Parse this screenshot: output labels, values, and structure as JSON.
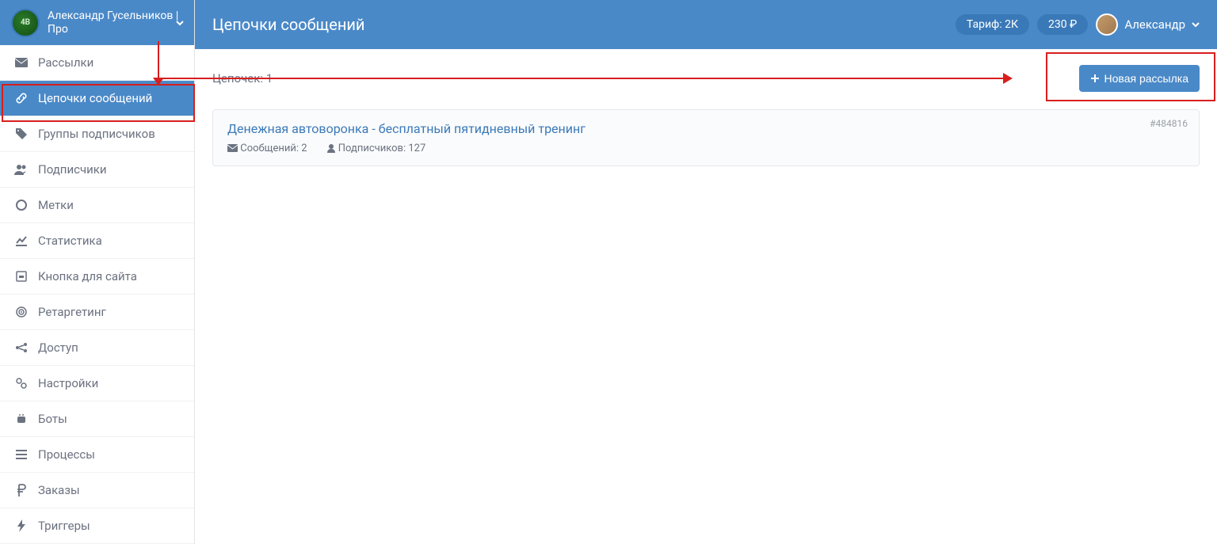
{
  "sidebar": {
    "profile": {
      "name": "Александр Гусельников | Про",
      "avatar_text": "4B"
    },
    "items": [
      {
        "label": "Рассылки",
        "icon": "envelope"
      },
      {
        "label": "Цепочки сообщений",
        "icon": "chain",
        "active": true
      },
      {
        "label": "Группы подписчиков",
        "icon": "tags"
      },
      {
        "label": "Подписчики",
        "icon": "users"
      },
      {
        "label": "Метки",
        "icon": "circle"
      },
      {
        "label": "Статистика",
        "icon": "chart"
      },
      {
        "label": "Кнопка для сайта",
        "icon": "widget"
      },
      {
        "label": "Ретаргетинг",
        "icon": "target"
      },
      {
        "label": "Доступ",
        "icon": "share"
      },
      {
        "label": "Настройки",
        "icon": "cogs"
      },
      {
        "label": "Боты",
        "icon": "android"
      },
      {
        "label": "Процессы",
        "icon": "tasks"
      },
      {
        "label": "Заказы",
        "icon": "ruble"
      },
      {
        "label": "Триггеры",
        "icon": "bolt"
      }
    ]
  },
  "header": {
    "title": "Цепочки сообщений",
    "tariff": "Тариф: 2К",
    "balance": "230 ₽",
    "user_name": "Александр"
  },
  "content": {
    "count_text": "Цепочек: 1",
    "new_button": "Новая рассылка",
    "cards": [
      {
        "title": "Денежная автоворонка - бесплатный пятидневный тренинг",
        "messages": "Сообщений: 2",
        "subscribers": "Подписчиков: 127",
        "id": "#484816"
      }
    ]
  }
}
